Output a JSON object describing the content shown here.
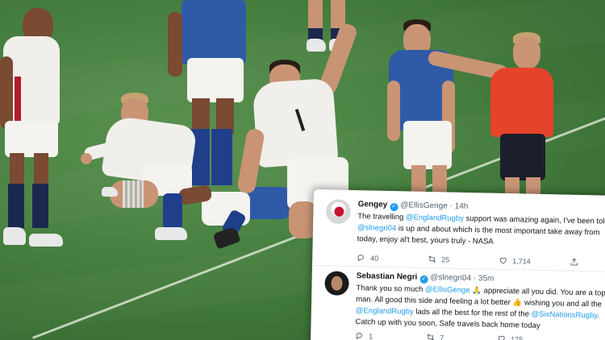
{
  "photo": {
    "description_icons": [
      "rugby-pitch",
      "players",
      "referee"
    ]
  },
  "tweets": [
    {
      "name": "Gengey",
      "handle": "@EllisGenge",
      "separator": "·",
      "time": "14h",
      "lines": [
        [
          {
            "t": "The travelling ",
            "m": false
          },
          {
            "t": "@EnglandRugby",
            "m": true
          },
          {
            "t": " support was amazing again, I've been told",
            "m": false
          }
        ],
        [
          {
            "t": "@slnegri04",
            "m": true
          },
          {
            "t": " is up and about which is the most important take away from",
            "m": false
          }
        ],
        [
          {
            "t": "today, enjoy al't best, yours truly - NASA",
            "m": false
          }
        ]
      ],
      "replies": "40",
      "retweets": "25",
      "likes": "1,714"
    },
    {
      "name": "Sebastian Negri",
      "handle": "@slnegri04",
      "separator": "·",
      "time": "35m",
      "lines": [
        [
          {
            "t": "Thank you so much ",
            "m": false
          },
          {
            "t": "@EllisGenge",
            "m": true
          },
          {
            "t": " 🙏 appreciate all you did. You are a top",
            "m": false
          }
        ],
        [
          {
            "t": "man. All good this side and feeling a lot better 👍 wishing you and all the",
            "m": false
          }
        ],
        [
          {
            "t": "@EnglandRugby",
            "m": true
          },
          {
            "t": " lads all the best for the rest of the ",
            "m": false
          },
          {
            "t": "@SixNationsRugby",
            "m": true
          },
          {
            "t": ".",
            "m": false
          }
        ],
        [
          {
            "t": "Catch up with you soon, Safe travels back home today",
            "m": false
          }
        ]
      ],
      "replies": "1",
      "retweets": "7",
      "likes": "175"
    }
  ],
  "colors": {
    "pitch": "#4b8444",
    "mention": "#1d9bf0",
    "verified": "#1d9bf0",
    "italy_blue": "#2f5aa8",
    "referee_red": "#e5432a"
  }
}
